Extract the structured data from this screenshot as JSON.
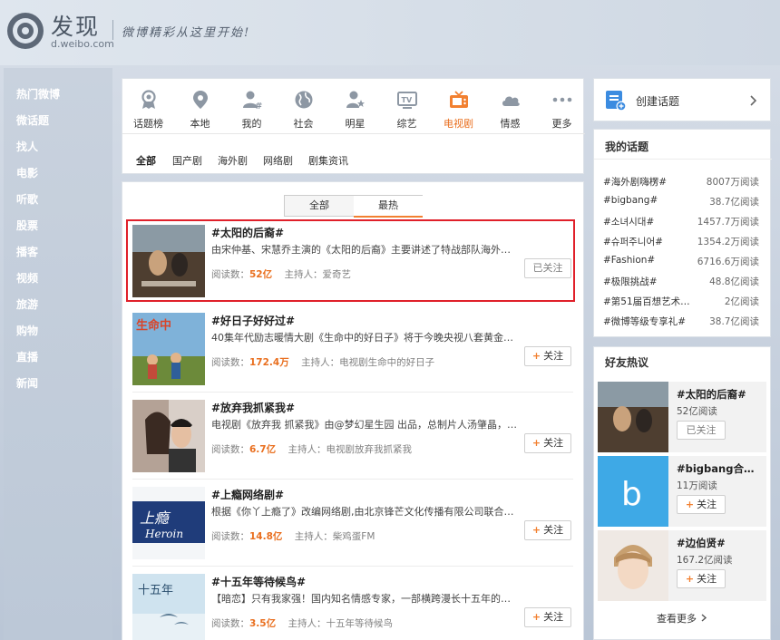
{
  "header": {
    "title": "发现",
    "url": "d.weibo.com",
    "slogan": "微博精彩从这里开始!"
  },
  "sidebar": {
    "items": [
      "热门微博",
      "微话题",
      "找人",
      "电影",
      "听歌",
      "股票",
      "播客",
      "视频",
      "旅游",
      "购物",
      "直播",
      "新闻"
    ],
    "active_index": 1
  },
  "categories": [
    {
      "label": "话题榜",
      "icon": "medal-icon"
    },
    {
      "label": "本地",
      "icon": "location-pin-icon"
    },
    {
      "label": "我的",
      "icon": "user-topic-icon"
    },
    {
      "label": "社会",
      "icon": "globe-icon"
    },
    {
      "label": "明星",
      "icon": "star-user-icon"
    },
    {
      "label": "综艺",
      "icon": "tv-icon"
    },
    {
      "label": "电视剧",
      "icon": "tv-drama-icon"
    },
    {
      "label": "情感",
      "icon": "cloud-heart-icon"
    },
    {
      "label": "更多",
      "icon": "more-dots-icon"
    }
  ],
  "active_category": 6,
  "subtabs": [
    "全部",
    "国产剧",
    "海外剧",
    "网络剧",
    "剧集资讯"
  ],
  "toggle": {
    "all": "全部",
    "hot": "最热"
  },
  "labels": {
    "read": "阅读数：",
    "host": "主持人：",
    "follow": "关注",
    "followed": "已关注",
    "plus": "+"
  },
  "topics": [
    {
      "title": "#太阳的后裔#",
      "desc": "由宋仲基、宋慧乔主演的《太阳的后裔》主要讲述了特战部队海外派兵组...",
      "reads": "52亿",
      "host": "爱奇艺",
      "followed": true
    },
    {
      "title": "#好日子好好过#",
      "desc": "40集年代励志暖情大剧《生命中的好日子》将于今晚央视八套黄金时段完...",
      "reads": "172.4万",
      "host": "电视剧生命中的好日子",
      "followed": false
    },
    {
      "title": "#放弃我抓紧我#",
      "desc": "电视剧《放弃我 抓紧我》由@梦幻星生园 出品，总制片人汤肇晶，制片人...",
      "reads": "6.7亿",
      "host": "电视剧放弃我抓紧我",
      "followed": false
    },
    {
      "title": "#上瘾网络剧#",
      "desc": "根据《你丫上瘾了》改编网络剧,由北京锋芒文化传播有限公司联合北京振...",
      "reads": "14.8亿",
      "host": "柴鸡蛋FM",
      "followed": false
    },
    {
      "title": "#十五年等待候鸟#",
      "desc": "【暗恋】只有我家强！国内知名情感专家，一部横跨漫长十五年的暗恋史诗！",
      "reads": "3.5亿",
      "host": "十五年等待候鸟",
      "followed": false
    }
  ],
  "create_topic": "创建话题",
  "my_topics": {
    "title": "我的话题",
    "items": [
      {
        "name": "#海外剧嗨楞#",
        "count": "8007万阅读"
      },
      {
        "name": "#bigbang#",
        "count": "38.7亿阅读"
      },
      {
        "name": "#소녀시대#",
        "count": "1457.7万阅读"
      },
      {
        "name": "#슈퍼주니어#",
        "count": "1354.2万阅读"
      },
      {
        "name": "#Fashion#",
        "count": "6716.6万阅读"
      },
      {
        "name": "#极限挑战#",
        "count": "48.8亿阅读"
      },
      {
        "name": "#第51届百想艺术大...",
        "count": "2亿阅读"
      },
      {
        "name": "#微博等级专享礼#",
        "count": "38.7亿阅读"
      }
    ]
  },
  "friends": {
    "title": "好友热议",
    "items": [
      {
        "name": "#太阳的后裔#",
        "count": "52亿阅读",
        "followed": true
      },
      {
        "name": "#bigbang合肥...",
        "count": "11万阅读",
        "followed": false
      },
      {
        "name": "#边伯贤#",
        "count": "167.2亿阅读",
        "followed": false
      }
    ],
    "see_more": "查看更多"
  },
  "colors": {
    "accent": "#f28030",
    "highlight": "#e0202a",
    "bigbang_blue": "#3ea9e6"
  }
}
